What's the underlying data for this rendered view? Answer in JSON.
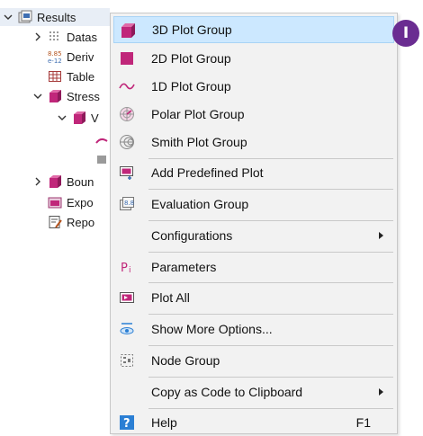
{
  "tree": {
    "results": "Results",
    "items": [
      "Datas",
      "Deriv",
      "Table",
      "Stress",
      "V",
      "Boun",
      "Expo",
      "Repo"
    ]
  },
  "menu": {
    "items": [
      {
        "label": "3D Plot Group",
        "icon": "3d-plot-group-icon"
      },
      {
        "label": "2D Plot Group",
        "icon": "2d-plot-group-icon"
      },
      {
        "label": "1D Plot Group",
        "icon": "1d-plot-group-icon"
      },
      {
        "label": "Polar Plot Group",
        "icon": "polar-plot-group-icon"
      },
      {
        "label": "Smith Plot Group",
        "icon": "smith-plot-group-icon"
      },
      {
        "label": "Add Predefined Plot",
        "icon": "add-predefined-plot-icon"
      },
      {
        "label": "Evaluation Group",
        "icon": "evaluation-group-icon"
      },
      {
        "label": "Configurations",
        "icon": ""
      },
      {
        "label": "Parameters",
        "icon": "parameters-icon"
      },
      {
        "label": "Plot All",
        "icon": "plot-all-icon"
      },
      {
        "label": "Show More Options...",
        "icon": "show-more-options-icon"
      },
      {
        "label": "Node Group",
        "icon": "node-group-icon"
      },
      {
        "label": "Copy as Code to Clipboard",
        "icon": ""
      },
      {
        "label": "Help",
        "icon": "help-icon",
        "shortcut": "F1"
      }
    ]
  },
  "callout": "I",
  "colors": {
    "highlight": "#cce8ff",
    "plot_group": "#c0277a",
    "callout": "#6a2c91"
  }
}
